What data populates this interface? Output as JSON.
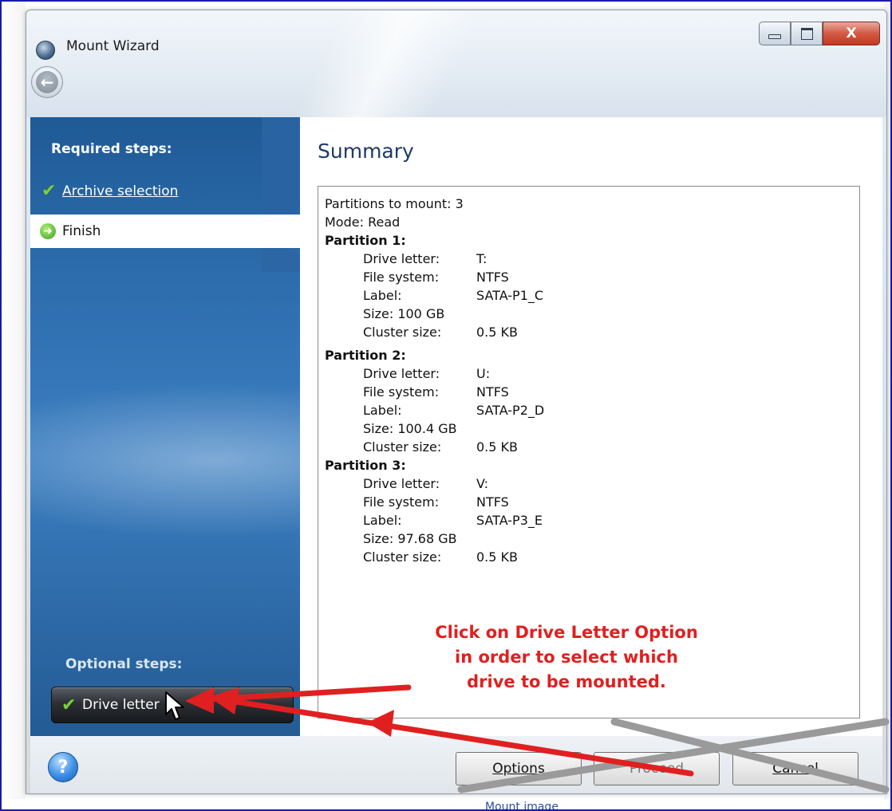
{
  "window": {
    "title": "Mount Wizard",
    "close_glyph": "X"
  },
  "sidebar": {
    "required_heading": "Required steps:",
    "optional_heading": "Optional steps:",
    "archive_selection": "Archive selection",
    "finish": "Finish",
    "drive_letter": "Drive letter"
  },
  "content": {
    "title": "Summary",
    "partitions_to_mount": "Partitions to mount: 3",
    "mode": "Mode: Read",
    "partitions": [
      {
        "heading": "Partition 1:",
        "drive_letter_key": "Drive letter:",
        "drive_letter": "T:",
        "fs_key": "File system:",
        "fs": "NTFS",
        "label_key": "Label:",
        "label": "SATA-P1_C",
        "size": "Size: 100 GB",
        "cluster_key": "Cluster size:",
        "cluster": "0.5 KB"
      },
      {
        "heading": "Partition 2:",
        "drive_letter_key": "Drive letter:",
        "drive_letter": "U:",
        "fs_key": "File system:",
        "fs": "NTFS",
        "label_key": "Label:",
        "label": "SATA-P2_D",
        "size": "Size: 100.4 GB",
        "cluster_key": "Cluster size:",
        "cluster": "0.5 KB"
      },
      {
        "heading": "Partition 3:",
        "drive_letter_key": "Drive letter:",
        "drive_letter": "V:",
        "fs_key": "File system:",
        "fs": "NTFS",
        "label_key": "Label:",
        "label": "SATA-P3_E",
        "size": "Size: 97.68 GB",
        "cluster_key": "Cluster size:",
        "cluster": "0.5 KB"
      }
    ]
  },
  "buttons": {
    "help": "?",
    "options": "Options",
    "proceed": "Proceed",
    "cancel": "Cancel"
  },
  "annotation": {
    "line1": "Click on Drive Letter Option",
    "line2": "in order to select which",
    "line3": "drive to be mounted."
  },
  "footer": {
    "caption": "Mount image"
  },
  "colors": {
    "annotation_red": "#e02020",
    "sidebar_blue": "#2f6fb0",
    "frame_blue": "#1a1aa6"
  }
}
